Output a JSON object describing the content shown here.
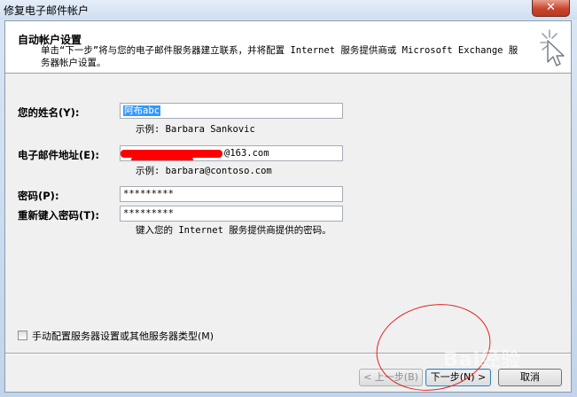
{
  "window": {
    "title": "修复电子邮件帐户",
    "close_symbol": "✕"
  },
  "header": {
    "title": "自动帐户设置",
    "description": "单击“下一步”将与您的电子邮件服务器建立联系，并将配置 Internet 服务提供商或 Microsoft Exchange 服务器帐户设置。",
    "icon": "wizard-cursor-sparkle-icon"
  },
  "form": {
    "name": {
      "label": "您的姓名(Y):",
      "value": "阿布abc",
      "hint": "示例: Barbara Sankovic"
    },
    "email": {
      "label": "电子邮件地址(E):",
      "value_visible": "@163.com",
      "hint": "示例: barbara@contoso.com"
    },
    "password": {
      "label": "密码(P):",
      "value": "*********"
    },
    "password_confirm": {
      "label": "重新键入密码(T):",
      "value": "*********",
      "hint": "键入您的 Internet 服务提供商提供的密码。"
    }
  },
  "manual_config": {
    "label": "手动配置服务器设置或其他服务器类型(M)",
    "checked": false
  },
  "buttons": {
    "back": "< 上一步(B)",
    "next": "下一步(N) >",
    "cancel": "取消"
  },
  "watermark": "Bai经验",
  "colors": {
    "redaction": "#ff0000",
    "annotation_circle": "#e0231f",
    "selection": "#3399ff"
  }
}
